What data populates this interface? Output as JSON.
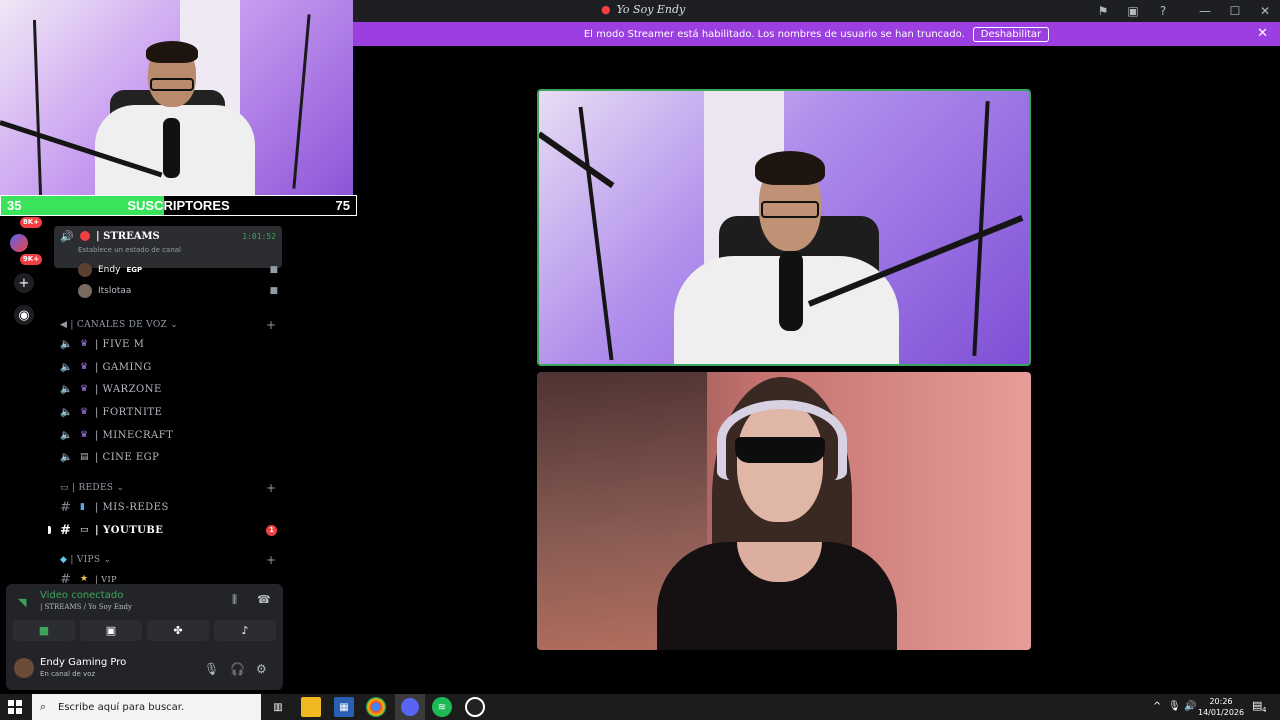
{
  "window": {
    "title": "Yo Soy Endy"
  },
  "banner": {
    "text": "El modo Streamer está habilitado. Los nombres de usuario se han truncado.",
    "button": "Deshabilitar"
  },
  "overlay": {
    "left_value": "35",
    "label": "SUSCRIPTORES",
    "right_value": "75",
    "progress_fraction": 0.46
  },
  "rail": {
    "badges": [
      "8K+",
      "9K+"
    ]
  },
  "sidebar": {
    "active_channel": {
      "name": "| STREAMS",
      "status": "Establece un estado de canal",
      "timer": "1:01:52"
    },
    "voice_users": [
      {
        "name": "Endy",
        "tag": "EGP"
      },
      {
        "name": "Itslotaa",
        "tag": ""
      }
    ],
    "voice_category": "| CANALES DE VOZ",
    "voice_channels": [
      {
        "name": "| FIVE M"
      },
      {
        "name": "|  GAMING"
      },
      {
        "name": "| WARZONE"
      },
      {
        "name": "| FORTNITE"
      },
      {
        "name": "| MINECRAFT"
      },
      {
        "name": "| CINE EGP"
      }
    ],
    "redes_category": "| REDES",
    "redes_channels": [
      {
        "name": "| MIS-REDES"
      },
      {
        "name": "| YOUTUBE",
        "unread": "1"
      }
    ],
    "vips_category": "| VIPS",
    "vips_channels": [
      {
        "name": "| VIP"
      }
    ]
  },
  "voice_panel": {
    "status": "Video conectado",
    "channel": "| STREAMS / Yo Soy Endy",
    "username": "Endy Gaming Pro",
    "user_status": "En canal de voz"
  },
  "taskbar": {
    "search_placeholder": "Escribe aquí para buscar.",
    "time": "20:26",
    "date": "14/01/2026",
    "notifications": "4"
  },
  "colors": {
    "banner": "#9b3fe0",
    "connected_green": "#3ba55c",
    "unread_red": "#f23f43",
    "progress_green": "#39e45a"
  }
}
